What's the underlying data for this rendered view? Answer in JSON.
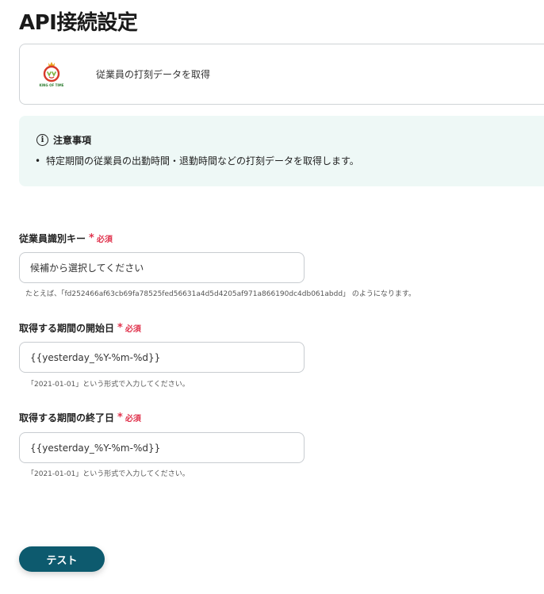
{
  "page_title": "API接続設定",
  "app_card": {
    "logo_icon": "kingoftime-logo-icon",
    "logo_text": "KING OF TIME",
    "action_label": "従業員の打刻データを取得"
  },
  "notice": {
    "icon": "info-icon",
    "title": "注意事項",
    "items": [
      "特定期間の従業員の出勤時間・退勤時間などの打刻データを取得します。"
    ]
  },
  "fields": [
    {
      "label": "従業員識別キー",
      "required_mark": "*",
      "required_text": "必須",
      "value": "候補から選択してください",
      "hint": "たとえば、「fd252466af63cb69fa78525fed56631a4d5d4205af971a866190dc4db061abdd」 のようになります。"
    },
    {
      "label": "取得する期間の開始日",
      "required_mark": "*",
      "required_text": "必須",
      "value": "{{yesterday_%Y-%m-%d}}",
      "hint": "「2021-01-01」という形式で入力してください。"
    },
    {
      "label": "取得する期間の終了日",
      "required_mark": "*",
      "required_text": "必須",
      "value": "{{yesterday_%Y-%m-%d}}",
      "hint": "「2021-01-01」という形式で入力してください。"
    }
  ],
  "test_button_label": "テスト",
  "colors": {
    "accent": "#0d5a6e",
    "required": "#e0334d",
    "notice_bg": "#eef8f6"
  }
}
